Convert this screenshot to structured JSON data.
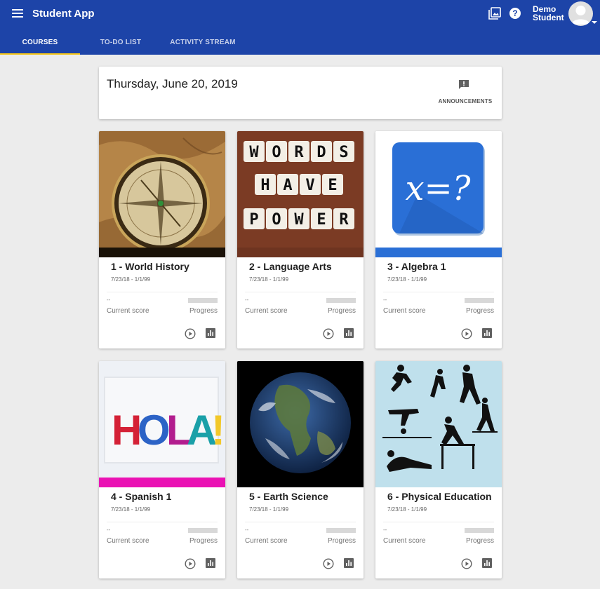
{
  "app": {
    "title": "Student App"
  },
  "user": {
    "first": "Demo",
    "last": "Student"
  },
  "header_icons": [
    "gallery-icon",
    "help-icon"
  ],
  "tabs": [
    {
      "label": "COURSES",
      "active": true
    },
    {
      "label": "TO-DO LIST",
      "active": false
    },
    {
      "label": "ACTIVITY STREAM",
      "active": false
    }
  ],
  "date_card": {
    "date": "Thursday, June 20, 2019",
    "announcements_label": "ANNOUNCEMENTS"
  },
  "colors": {
    "brand": "#1d44a8",
    "tab_indicator": "#f5c518",
    "algebra_band": "#2a6fd6",
    "spanish_band": "#ea12b4"
  },
  "courses": [
    {
      "title": "1 - World History",
      "dates": "7/23/18 - 1/1/99",
      "score": "--",
      "score_label": "Current score",
      "progress_label": "Progress",
      "progress": 0,
      "image": "compass-map"
    },
    {
      "title": "2 - Language Arts",
      "dates": "7/23/18 - 1/1/99",
      "score": "--",
      "score_label": "Current score",
      "progress_label": "Progress",
      "progress": 0,
      "image": "words-have-power-tiles"
    },
    {
      "title": "3 - Algebra 1",
      "dates": "7/23/18 - 1/1/99",
      "score": "--",
      "score_label": "Current score",
      "progress_label": "Progress",
      "progress": 0,
      "image": "x-equals-question-tile",
      "image_text": "x=?"
    },
    {
      "title": "4 - Spanish 1",
      "dates": "7/23/18 - 1/1/99",
      "score": "--",
      "score_label": "Current score",
      "progress_label": "Progress",
      "progress": 0,
      "image": "hola-painted-letters",
      "image_text": "HOLA!"
    },
    {
      "title": "5 - Earth Science",
      "dates": "7/23/18 - 1/1/99",
      "score": "--",
      "score_label": "Current score",
      "progress_label": "Progress",
      "progress": 0,
      "image": "earth-globe"
    },
    {
      "title": "6 - Physical Education",
      "dates": "7/23/18 - 1/1/99",
      "score": "--",
      "score_label": "Current score",
      "progress_label": "Progress",
      "progress": 0,
      "image": "athlete-silhouettes"
    }
  ]
}
